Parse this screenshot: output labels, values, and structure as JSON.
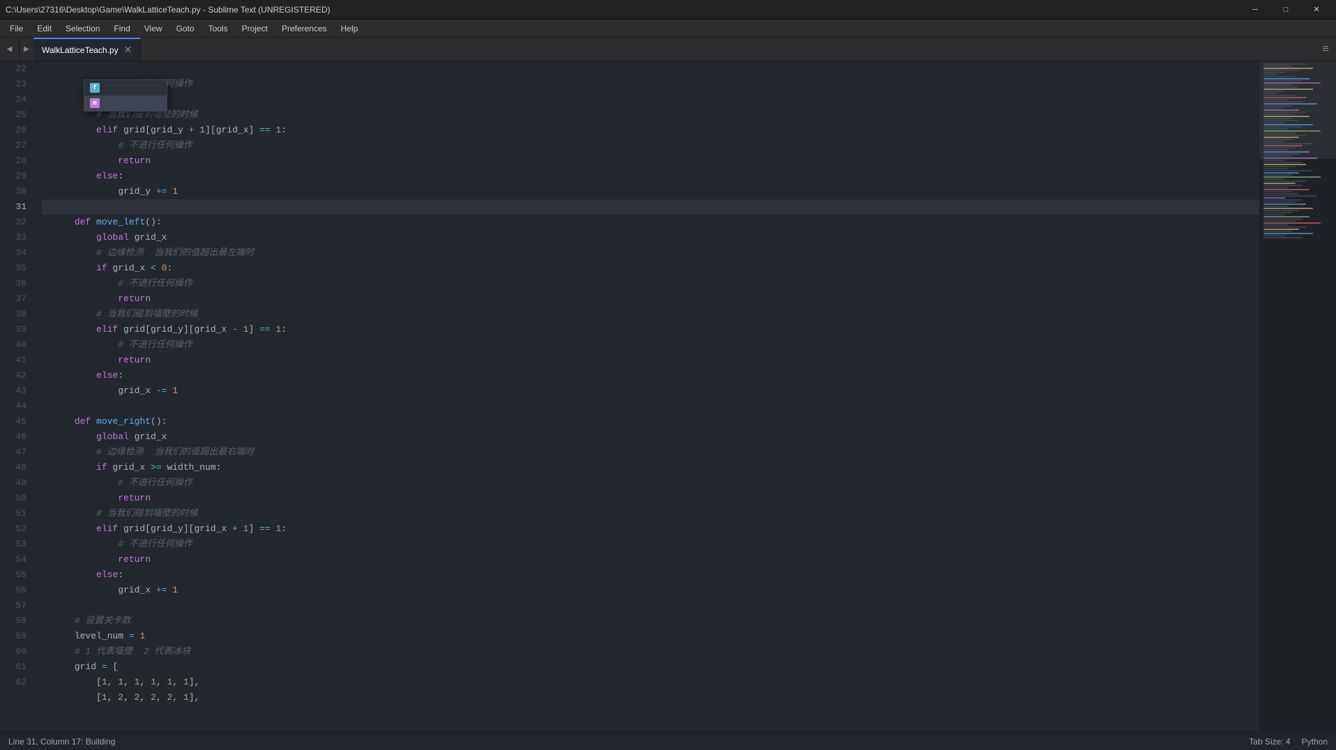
{
  "titleBar": {
    "title": "C:\\Users\\27316\\Desktop\\Game\\WalkLatticeTeach.py - Sublime Text (UNREGISTERED)",
    "minimize": "─",
    "maximize": "□",
    "close": "✕"
  },
  "menuBar": {
    "items": [
      "File",
      "Edit",
      "Selection",
      "Find",
      "View",
      "Goto",
      "Tools",
      "Project",
      "Preferences",
      "Help"
    ]
  },
  "tabs": [
    {
      "label": "WalkLatticeTeach.py",
      "active": true
    }
  ],
  "statusBar": {
    "left": "Line 31, Column 17: Building",
    "tabSize": "Tab Size: 4",
    "language": "Python"
  },
  "lines": [
    {
      "num": 22,
      "active": false
    },
    {
      "num": 23,
      "active": false
    },
    {
      "num": 24,
      "active": false
    },
    {
      "num": 25,
      "active": false
    },
    {
      "num": 26,
      "active": false
    },
    {
      "num": 27,
      "active": false
    },
    {
      "num": 28,
      "active": false
    },
    {
      "num": 29,
      "active": false
    },
    {
      "num": 30,
      "active": false
    },
    {
      "num": 31,
      "active": true
    },
    {
      "num": 32,
      "active": false
    },
    {
      "num": 33,
      "active": false
    },
    {
      "num": 34,
      "active": false
    },
    {
      "num": 35,
      "active": false
    },
    {
      "num": 36,
      "active": false
    },
    {
      "num": 37,
      "active": false
    },
    {
      "num": 38,
      "active": false
    },
    {
      "num": 39,
      "active": false
    },
    {
      "num": 40,
      "active": false
    },
    {
      "num": 41,
      "active": false
    },
    {
      "num": 42,
      "active": false
    },
    {
      "num": 43,
      "active": false
    },
    {
      "num": 44,
      "active": false
    },
    {
      "num": 45,
      "active": false
    },
    {
      "num": 46,
      "active": false
    },
    {
      "num": 47,
      "active": false
    },
    {
      "num": 48,
      "active": false
    },
    {
      "num": 49,
      "active": false
    },
    {
      "num": 50,
      "active": false
    },
    {
      "num": 51,
      "active": false
    },
    {
      "num": 52,
      "active": false
    },
    {
      "num": 53,
      "active": false
    },
    {
      "num": 54,
      "active": false
    },
    {
      "num": 55,
      "active": false
    },
    {
      "num": 56,
      "active": false
    },
    {
      "num": 57,
      "active": false
    },
    {
      "num": 58,
      "active": false
    },
    {
      "num": 59,
      "active": false
    },
    {
      "num": 60,
      "active": false
    },
    {
      "num": 61,
      "active": false
    },
    {
      "num": 62,
      "active": false
    }
  ]
}
